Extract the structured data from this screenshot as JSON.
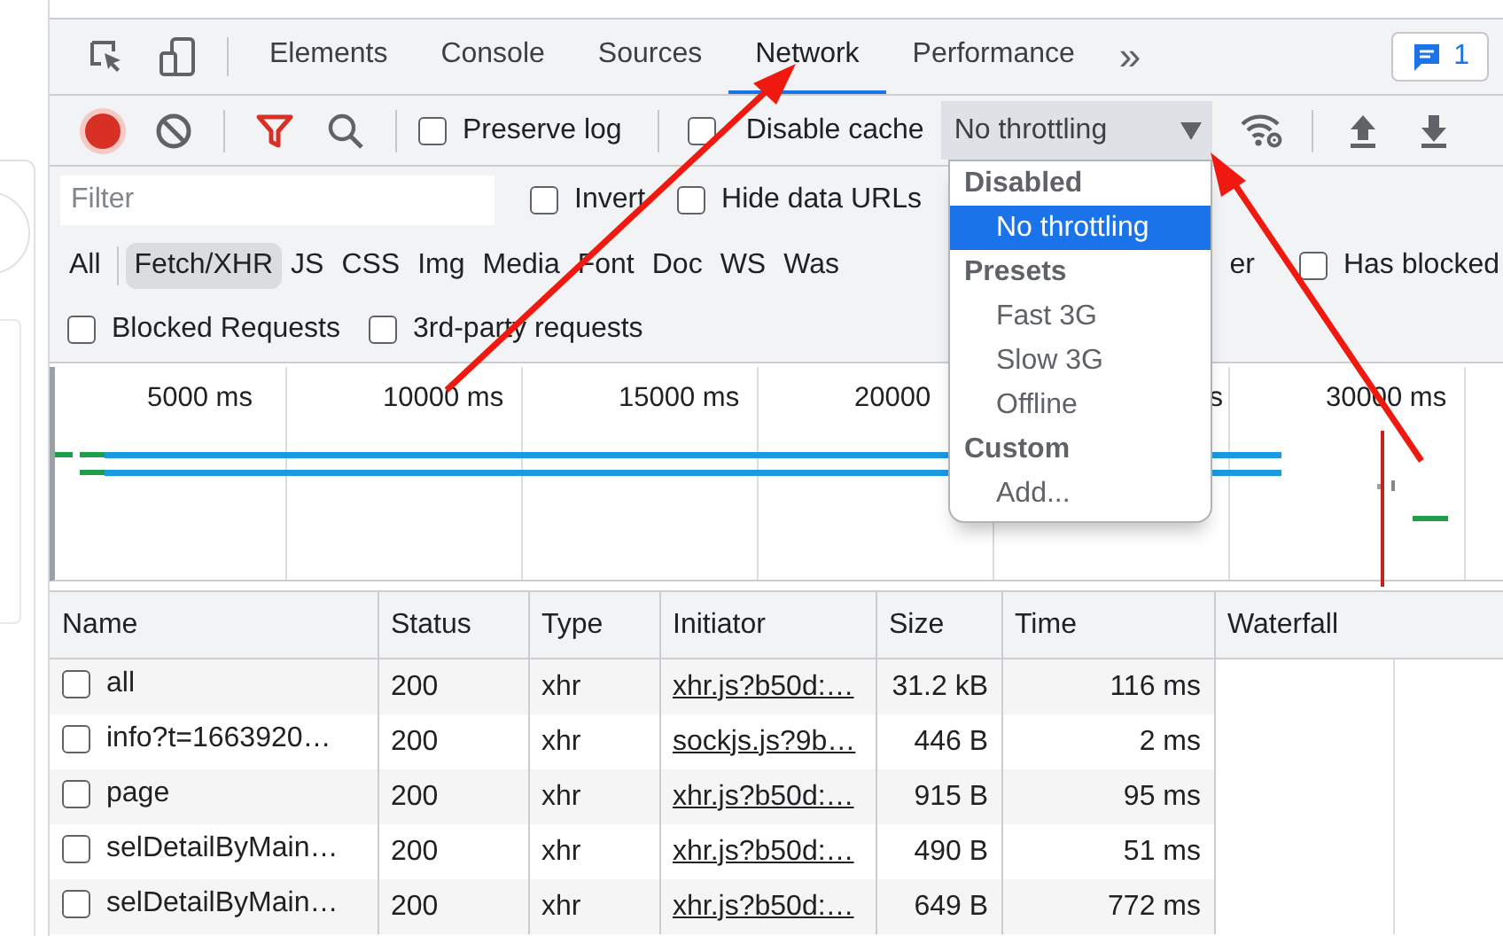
{
  "tabs": [
    {
      "label": "Elements",
      "selected": false
    },
    {
      "label": "Console",
      "selected": false
    },
    {
      "label": "Sources",
      "selected": false
    },
    {
      "label": "Network",
      "selected": true
    },
    {
      "label": "Performance",
      "selected": false
    }
  ],
  "more_tabs": "»",
  "issues_badge": {
    "count": "1"
  },
  "toolbar": {
    "recording": true,
    "preserve_log": {
      "label": "Preserve log",
      "checked": false
    },
    "disable_cache": {
      "label": "Disable cache",
      "checked": false
    },
    "throttling": {
      "value": "No throttling"
    }
  },
  "filter": {
    "placeholder": "Filter",
    "invert": {
      "label": "Invert",
      "checked": false
    },
    "hide_data_urls": {
      "label": "Hide data URLs",
      "checked": false
    }
  },
  "type_filters": [
    {
      "label": "All",
      "selected": false
    },
    {
      "label": "Fetch/XHR",
      "selected": true
    },
    {
      "label": "JS",
      "selected": false
    },
    {
      "label": "CSS",
      "selected": false
    },
    {
      "label": "Img",
      "selected": false
    },
    {
      "label": "Media",
      "selected": false
    },
    {
      "label": "Font",
      "selected": false
    },
    {
      "label": "Doc",
      "selected": false
    },
    {
      "label": "WS",
      "selected": false
    },
    {
      "label": "Was",
      "selected": false
    },
    {
      "label": "er",
      "selected": false
    }
  ],
  "has_blocked": {
    "label": "Has blocked",
    "checked": false
  },
  "blocked_requests": {
    "label": "Blocked Requests",
    "checked": false
  },
  "third_party": {
    "label": "3rd-party requests",
    "checked": false
  },
  "timeline": {
    "ticks": [
      {
        "label": "5000 ms",
        "kind": "label"
      },
      {
        "label": "10000 ms",
        "kind": "label"
      },
      {
        "label": "15000 ms",
        "kind": "label"
      },
      {
        "label": "20000",
        "kind": "label"
      },
      {
        "label": "s",
        "kind": "tail"
      },
      {
        "label": "30000 ms",
        "kind": "label"
      }
    ]
  },
  "table": {
    "columns": [
      "Name",
      "Status",
      "Type",
      "Initiator",
      "Size",
      "Time",
      "Waterfall"
    ],
    "rows": [
      {
        "checked": false,
        "name": "all",
        "status": "200",
        "type": "xhr",
        "initiator": "xhr.js?b50d:…",
        "size": "31.2 kB",
        "time": "116 ms"
      },
      {
        "checked": false,
        "name": "info?t=1663920…",
        "status": "200",
        "type": "xhr",
        "initiator": "sockjs.js?9b…",
        "size": "446 B",
        "time": "2 ms"
      },
      {
        "checked": false,
        "name": "page",
        "status": "200",
        "type": "xhr",
        "initiator": "xhr.js?b50d:…",
        "size": "915 B",
        "time": "95 ms"
      },
      {
        "checked": false,
        "name": "selDetailByMain…",
        "status": "200",
        "type": "xhr",
        "initiator": "xhr.js?b50d:…",
        "size": "490 B",
        "time": "51 ms"
      },
      {
        "checked": false,
        "name": "selDetailByMain…",
        "status": "200",
        "type": "xhr",
        "initiator": "xhr.js?b50d:…",
        "size": "649 B",
        "time": "772 ms"
      }
    ]
  },
  "throttle_menu": {
    "sections": [
      {
        "heading": "Disabled",
        "items": [
          {
            "label": "No throttling",
            "selected": true
          }
        ]
      },
      {
        "heading": "Presets",
        "items": [
          {
            "label": "Fast 3G",
            "selected": false
          },
          {
            "label": "Slow 3G",
            "selected": false
          },
          {
            "label": "Offline",
            "selected": false
          }
        ]
      },
      {
        "heading": "Custom",
        "items": [
          {
            "label": "Add...",
            "selected": false
          }
        ]
      }
    ]
  }
}
